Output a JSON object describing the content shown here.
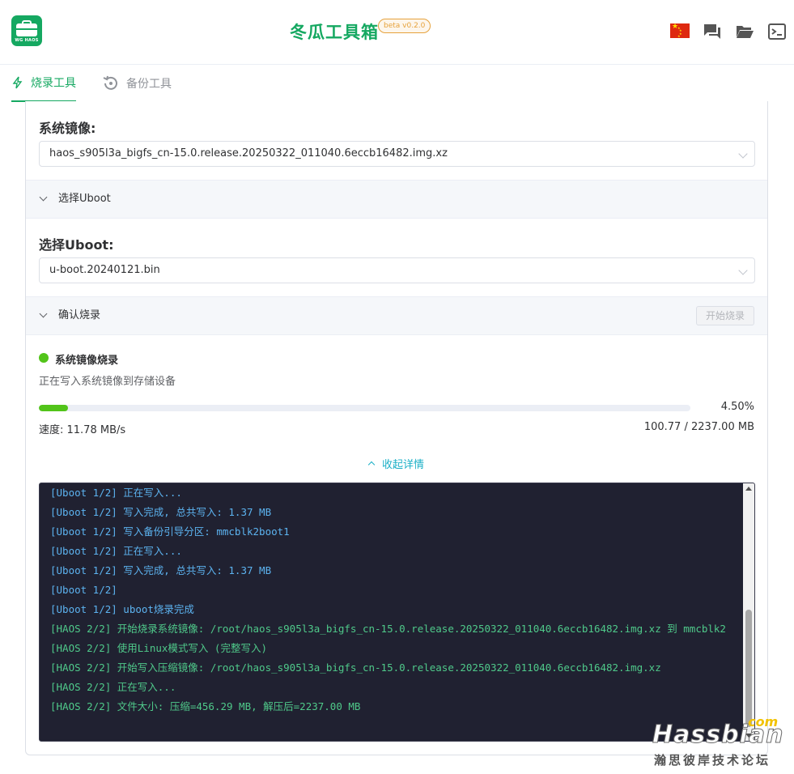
{
  "header": {
    "logo_text": "WG HAOS",
    "title": "冬瓜工具箱",
    "version_badge": "beta v0.2.0",
    "icons": [
      "flag-cn-icon",
      "chat-icon",
      "folder-icon",
      "terminal-icon"
    ]
  },
  "tabs": [
    {
      "label": "烧录工具",
      "icon": "lightning-icon",
      "active": true
    },
    {
      "label": "备份工具",
      "icon": "backup-icon",
      "active": false
    }
  ],
  "system_image": {
    "label": "系统镜像:",
    "value": "haos_s905l3a_bigfs_cn-15.0.release.20250322_011040.6eccb16482.img.xz"
  },
  "uboot_section": {
    "bar_label": "选择Uboot",
    "label": "选择Uboot:",
    "value": "u-boot.20240121.bin"
  },
  "confirm_section": {
    "bar_label": "确认烧录",
    "start_button": "开始烧录"
  },
  "progress": {
    "title": "系统镜像烧录",
    "description": "正在写入系统镜像到存储设备",
    "percent_text": "4.50%",
    "percent": 4.5,
    "speed_text": "速度: 11.78 MB/s",
    "size_text": "100.77 / 2237.00 MB",
    "toggle_label": "收起详情"
  },
  "log": {
    "lines": [
      {
        "text": "[Uboot 1/2] 正在写入...",
        "type": "uboot"
      },
      {
        "text": "[Uboot 1/2] 写入完成, 总共写入: 1.37 MB",
        "type": "uboot"
      },
      {
        "text": "[Uboot 1/2] 写入备份引导分区: mmcblk2boot1",
        "type": "uboot"
      },
      {
        "text": "[Uboot 1/2] 正在写入...",
        "type": "uboot"
      },
      {
        "text": "[Uboot 1/2] 写入完成, 总共写入: 1.37 MB",
        "type": "uboot"
      },
      {
        "text": "[Uboot 1/2]",
        "type": "uboot"
      },
      {
        "text": "[Uboot 1/2] uboot烧录完成",
        "type": "uboot"
      },
      {
        "text": "[HAOS 2/2] 开始烧录系统镜像: /root/haos_s905l3a_bigfs_cn-15.0.release.20250322_011040.6eccb16482.img.xz 到 mmcblk2",
        "type": "haos"
      },
      {
        "text": "[HAOS 2/2] 使用Linux模式写入 (完整写入)",
        "type": "haos"
      },
      {
        "text": "[HAOS 2/2] 开始写入压缩镜像: /root/haos_s905l3a_bigfs_cn-15.0.release.20250322_011040.6eccb16482.img.xz",
        "type": "haos"
      },
      {
        "text": "[HAOS 2/2] 正在写入...",
        "type": "haos"
      },
      {
        "text": "[HAOS 2/2] 文件大小: 压缩=456.29 MB, 解压后=2237.00 MB",
        "type": "haos"
      }
    ]
  },
  "watermark": {
    "com": ".com",
    "name": "Hassbian",
    "sub": "瀚思彼岸技术论坛"
  },
  "colors": {
    "brand": "#15a861",
    "progress": "#52c41a",
    "link": "#1cb0c7",
    "log_bg": "#202131",
    "log_uboot": "#5cb3f0",
    "log_haos": "#4fc98a"
  }
}
